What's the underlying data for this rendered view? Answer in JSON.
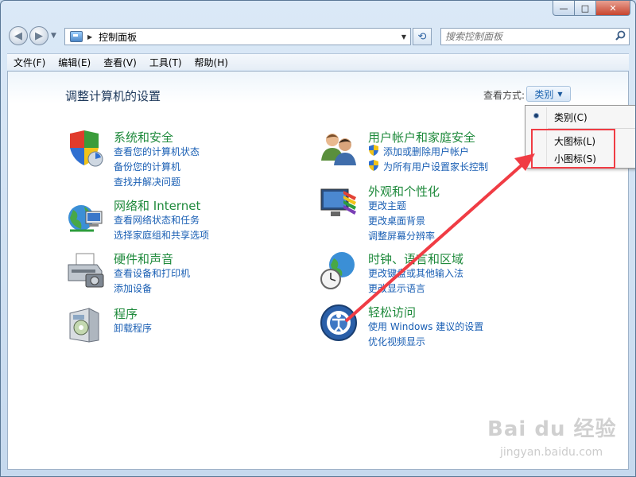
{
  "window": {
    "caption_buttons": {
      "minimize": "—",
      "maximize": "□",
      "close": "✕"
    }
  },
  "address_bar": {
    "path": "控制面板",
    "search_placeholder": "搜索控制面板",
    "icons": [
      "back-icon",
      "forward-icon",
      "control-panel-icon",
      "refresh-icon",
      "search-icon"
    ]
  },
  "menu": [
    "文件(F)",
    "编辑(E)",
    "查看(V)",
    "工具(T)",
    "帮助(H)"
  ],
  "content": {
    "title": "调整计算机的设置",
    "view_by_label": "查看方式:",
    "view_by_value": "类别"
  },
  "view_menu": {
    "items": [
      {
        "label": "类别(C)",
        "selected": true
      },
      {
        "label": "大图标(L)",
        "selected": false
      },
      {
        "label": "小图标(S)",
        "selected": false
      }
    ],
    "highlight_color": "#f03c44"
  },
  "categories": {
    "system": {
      "title": "系统和安全",
      "links": [
        "查看您的计算机状态",
        "备份您的计算机",
        "查找并解决问题"
      ]
    },
    "network": {
      "title": "网络和 Internet",
      "links": [
        "查看网络状态和任务",
        "选择家庭组和共享选项"
      ]
    },
    "hardware": {
      "title": "硬件和声音",
      "links": [
        "查看设备和打印机",
        "添加设备"
      ]
    },
    "programs": {
      "title": "程序",
      "links": [
        "卸载程序"
      ]
    },
    "users": {
      "title": "用户帐户和家庭安全",
      "links": [
        "添加或删除用户帐户",
        "为所有用户设置家长控制"
      ]
    },
    "appearance": {
      "title": "外观和个性化",
      "links": [
        "更改主题",
        "更改桌面背景",
        "调整屏幕分辨率"
      ]
    },
    "clock": {
      "title": "时钟、语言和区域",
      "links": [
        "更改键盘或其他输入法",
        "更改显示语言"
      ]
    },
    "ease": {
      "title": "轻松访问",
      "links": [
        "使用 Windows 建议的设置",
        "优化视频显示"
      ]
    }
  },
  "colors": {
    "category_title": "#1f8a3c",
    "link": "#1a5fb4",
    "annotation_arrow": "#f03c44"
  },
  "watermark": {
    "brand": "Bai du 经验",
    "url": "jingyan.baidu.com"
  }
}
